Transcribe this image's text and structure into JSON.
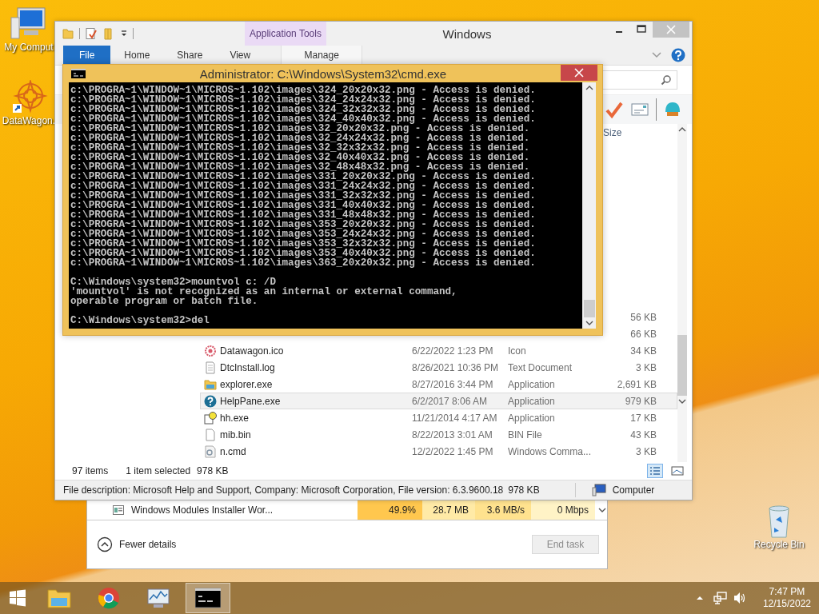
{
  "desktop_icons": [
    {
      "label": "My Comput",
      "kind": "computer"
    },
    {
      "label": "DataWagon.",
      "kind": "shortcut"
    }
  ],
  "recycle_bin": {
    "label": "Recycle Bin"
  },
  "task_manager": {
    "process": {
      "name": "Windows Modules Installer Wor...",
      "cpu": "49.9%",
      "memory": "28.7 MB",
      "disk": "3.6 MB/s",
      "network": "0 Mbps"
    },
    "fewer_details": "Fewer details",
    "end_task": {
      "label": "End task",
      "disabled": true
    }
  },
  "explorer": {
    "title": "Windows",
    "context_group": "Application Tools",
    "tabs": [
      {
        "label": "File",
        "kind": "file",
        "selected": false
      },
      {
        "label": "Home",
        "kind": "tab",
        "selected": false
      },
      {
        "label": "Share",
        "kind": "tab",
        "selected": false
      },
      {
        "label": "View",
        "kind": "tab",
        "selected": false
      },
      {
        "label": "Manage",
        "kind": "contextual",
        "selected": false
      }
    ],
    "size_column": "Size",
    "files": [
      {
        "size": "56 KB",
        "selected": false
      },
      {
        "size": "66 KB",
        "selected": false
      },
      {
        "kind": "ico",
        "name": "Datawagon.ico",
        "date": "6/22/2022 1:23 PM",
        "type": "Icon",
        "size": "34 KB",
        "selected": false
      },
      {
        "kind": "log",
        "name": "DtcInstall.log",
        "date": "8/26/2021 10:36 PM",
        "type": "Text Document",
        "size": "3 KB",
        "selected": false
      },
      {
        "kind": "explorer",
        "name": "explorer.exe",
        "date": "8/27/2016 3:44 PM",
        "type": "Application",
        "size": "2,691 KB",
        "selected": false
      },
      {
        "kind": "help",
        "name": "HelpPane.exe",
        "date": "6/2/2017 8:06 AM",
        "type": "Application",
        "size": "979 KB",
        "selected": true
      },
      {
        "kind": "hh",
        "name": "hh.exe",
        "date": "11/21/2014 4:17 AM",
        "type": "Application",
        "size": "17 KB",
        "selected": false
      },
      {
        "kind": "bin",
        "name": "mib.bin",
        "date": "8/22/2013 3:01 AM",
        "type": "BIN File",
        "size": "43 KB",
        "selected": false
      },
      {
        "kind": "cmd",
        "name": "n.cmd",
        "date": "12/2/2022 1:45 PM",
        "type": "Windows Comma...",
        "size": "3 KB",
        "selected": false
      }
    ],
    "item_count": "97 items",
    "selection": "1 item selected",
    "selection_size": "978 KB",
    "details": "File description: Microsoft Help and Support, Company: Microsoft Corporation, File version: 6.3.9600.18",
    "details_size": "978 KB",
    "location": "Computer"
  },
  "cmd": {
    "title": "Administrator: C:\\Windows\\System32\\cmd.exe",
    "blocks": [
      [
        "c:\\PROGRA~1\\WINDOW~1\\MICROS~1.102\\images\\324_20x20x32.png - Access is denied.",
        "c:\\PROGRA~1\\WINDOW~1\\MICROS~1.102\\images\\324_24x24x32.png - Access is denied.",
        "c:\\PROGRA~1\\WINDOW~1\\MICROS~1.102\\images\\324_32x32x32.png - Access is denied.",
        "c:\\PROGRA~1\\WINDOW~1\\MICROS~1.102\\images\\324_40x40x32.png - Access is denied.",
        "c:\\PROGRA~1\\WINDOW~1\\MICROS~1.102\\images\\32_20x20x32.png - Access is denied.",
        "c:\\PROGRA~1\\WINDOW~1\\MICROS~1.102\\images\\32_24x24x32.png - Access is denied.",
        "c:\\PROGRA~1\\WINDOW~1\\MICROS~1.102\\images\\32_32x32x32.png - Access is denied.",
        "c:\\PROGRA~1\\WINDOW~1\\MICROS~1.102\\images\\32_40x40x32.png - Access is denied.",
        "c:\\PROGRA~1\\WINDOW~1\\MICROS~1.102\\images\\32_48x48x32.png - Access is denied.",
        "c:\\PROGRA~1\\WINDOW~1\\MICROS~1.102\\images\\331_20x20x32.png - Access is denied.",
        "c:\\PROGRA~1\\WINDOW~1\\MICROS~1.102\\images\\331_24x24x32.png - Access is denied.",
        "c:\\PROGRA~1\\WINDOW~1\\MICROS~1.102\\images\\331_32x32x32.png - Access is denied.",
        "c:\\PROGRA~1\\WINDOW~1\\MICROS~1.102\\images\\331_40x40x32.png - Access is denied.",
        "c:\\PROGRA~1\\WINDOW~1\\MICROS~1.102\\images\\331_48x48x32.png - Access is denied.",
        "c:\\PROGRA~1\\WINDOW~1\\MICROS~1.102\\images\\353_20x20x32.png - Access is denied.",
        "c:\\PROGRA~1\\WINDOW~1\\MICROS~1.102\\images\\353_24x24x32.png - Access is denied.",
        "c:\\PROGRA~1\\WINDOW~1\\MICROS~1.102\\images\\353_32x32x32.png - Access is denied.",
        "c:\\PROGRA~1\\WINDOW~1\\MICROS~1.102\\images\\353_40x40x32.png - Access is denied.",
        "c:\\PROGRA~1\\WINDOW~1\\MICROS~1.102\\images\\363_20x20x32.png - Access is denied."
      ],
      [
        "C:\\Windows\\system32>mountvol c: /D",
        "'mountvol' is not recognized as an internal or external command,",
        "operable program or batch file."
      ],
      [
        "C:\\Windows\\system32>del"
      ]
    ]
  },
  "taskbar": {
    "apps": [
      {
        "kind": "explorer",
        "active": false
      },
      {
        "kind": "chrome",
        "active": false
      },
      {
        "kind": "monitor",
        "active": false
      },
      {
        "kind": "cmd",
        "active": true
      }
    ],
    "time": "7:47 PM",
    "date": "12/15/2022"
  }
}
